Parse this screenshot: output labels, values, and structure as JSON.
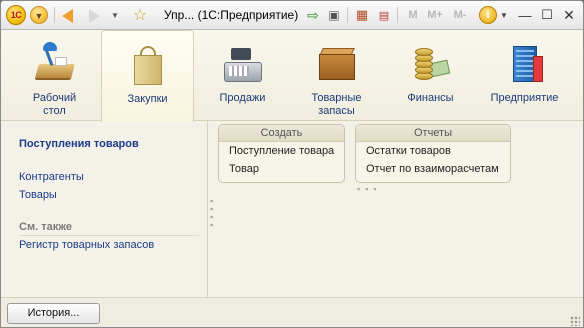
{
  "titlebar": {
    "logo": "1С",
    "title": "Упр... (1С:Предприятие)",
    "buttons": [
      "M",
      "M+",
      "M-"
    ]
  },
  "sections": [
    {
      "label": "Рабочий\nстол",
      "icon": "desk-lamp-icon"
    },
    {
      "label": "Закупки",
      "icon": "shopping-bag-icon",
      "active": true
    },
    {
      "label": "Продажи",
      "icon": "cash-register-icon"
    },
    {
      "label": "Товарные\nзапасы",
      "icon": "box-icon"
    },
    {
      "label": "Финансы",
      "icon": "coins-icon"
    },
    {
      "label": "Предприятие",
      "icon": "building-icon"
    }
  ],
  "left_panel": {
    "title": "Поступления товаров",
    "links": [
      "Контрагенты",
      "Товары"
    ],
    "see_also_title": "См. также",
    "see_also_links": [
      "Регистр товарных запасов"
    ]
  },
  "groups": {
    "create": {
      "title": "Создать",
      "items": [
        "Поступление товара",
        "Товар"
      ]
    },
    "reports": {
      "title": "Отчеты",
      "items": [
        "Остатки товаров",
        "Отчет по взаиморасчетам"
      ]
    }
  },
  "statusbar": {
    "history_label": "История..."
  },
  "colors": {
    "accent_link": "#1a3b8a",
    "background": "#f4f2e8"
  }
}
